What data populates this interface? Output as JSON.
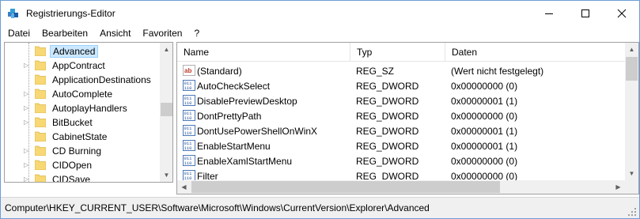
{
  "window": {
    "title": "Registrierungs-Editor",
    "accent": "#6a9fd4"
  },
  "menu": [
    {
      "label": "Datei"
    },
    {
      "label": "Bearbeiten"
    },
    {
      "label": "Ansicht"
    },
    {
      "label": "Favoriten"
    },
    {
      "label": "?"
    }
  ],
  "tree": {
    "items": [
      {
        "label": "Advanced",
        "expander": "",
        "selected": true
      },
      {
        "label": "AppContract",
        "expander": "▷"
      },
      {
        "label": "ApplicationDestinations",
        "expander": ""
      },
      {
        "label": "AutoComplete",
        "expander": "▷"
      },
      {
        "label": "AutoplayHandlers",
        "expander": "▷"
      },
      {
        "label": "BitBucket",
        "expander": "▷"
      },
      {
        "label": "CabinetState",
        "expander": ""
      },
      {
        "label": "CD Burning",
        "expander": "▷"
      },
      {
        "label": "CIDOpen",
        "expander": "▷"
      },
      {
        "label": "CIDSave",
        "expander": "▷"
      }
    ]
  },
  "list": {
    "headers": {
      "name": "Name",
      "type": "Typ",
      "data": "Daten"
    },
    "rows": [
      {
        "name": "(Standard)",
        "type": "REG_SZ",
        "data": "(Wert nicht festgelegt)",
        "icon": "string-value-icon"
      },
      {
        "name": "AutoCheckSelect",
        "type": "REG_DWORD",
        "data": "0x00000000 (0)",
        "icon": "binary-value-icon"
      },
      {
        "name": "DisablePreviewDesktop",
        "type": "REG_DWORD",
        "data": "0x00000001 (1)",
        "icon": "binary-value-icon"
      },
      {
        "name": "DontPrettyPath",
        "type": "REG_DWORD",
        "data": "0x00000000 (0)",
        "icon": "binary-value-icon"
      },
      {
        "name": "DontUsePowerShellOnWinX",
        "type": "REG_DWORD",
        "data": "0x00000001 (1)",
        "icon": "binary-value-icon"
      },
      {
        "name": "EnableStartMenu",
        "type": "REG_DWORD",
        "data": "0x00000001 (1)",
        "icon": "binary-value-icon"
      },
      {
        "name": "EnableXamlStartMenu",
        "type": "REG_DWORD",
        "data": "0x00000000 (0)",
        "icon": "binary-value-icon"
      },
      {
        "name": "Filter",
        "type": "REG_DWORD",
        "data": "0x00000000 (0)",
        "icon": "binary-value-icon"
      }
    ]
  },
  "status": {
    "path": "Computer\\HKEY_CURRENT_USER\\Software\\Microsoft\\Windows\\CurrentVersion\\Explorer\\Advanced"
  }
}
